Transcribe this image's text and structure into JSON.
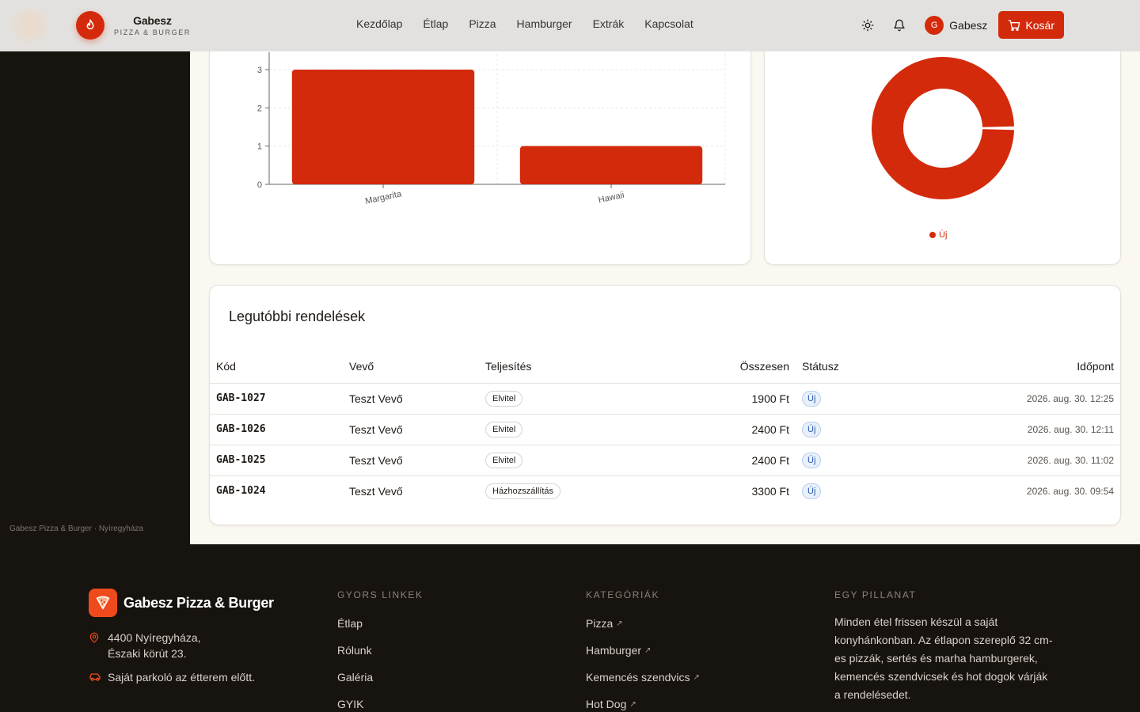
{
  "header": {
    "brand_name": "Gabesz",
    "brand_sub": "PIZZA & BURGER",
    "nav": [
      "Kezdőlap",
      "Étlap",
      "Pizza",
      "Hamburger",
      "Extrák",
      "Kapcsolat"
    ],
    "user_initial": "G",
    "user_name": "Gabesz",
    "cart_label": "Kosár"
  },
  "sidebar": {
    "footer_text": "Gabesz Pizza & Burger · Nyíregyháza"
  },
  "chart_data": [
    {
      "type": "bar",
      "categories": [
        "Margarita",
        "Hawaii"
      ],
      "values": [
        3,
        1
      ],
      "yticks": [
        "0",
        "1",
        "2",
        "3"
      ],
      "ylim": [
        0,
        3
      ],
      "color": "#d42a0c"
    },
    {
      "type": "pie",
      "variant": "donut",
      "labels": [
        "Új"
      ],
      "values": [
        100
      ],
      "legend": [
        "Új"
      ],
      "legend_position": "bottom",
      "color": "#d42a0c"
    }
  ],
  "orders": {
    "title": "Legutóbbi rendelések",
    "columns": [
      "Kód",
      "Vevő",
      "Teljesítés",
      "Összesen",
      "Státusz",
      "Időpont"
    ],
    "rows": [
      {
        "code": "GAB-1027",
        "buyer": "Teszt Vevő",
        "fulfil": "Elvitel",
        "total": "1900 Ft",
        "status": "Új",
        "time": "2026. aug. 30. 12:25"
      },
      {
        "code": "GAB-1026",
        "buyer": "Teszt Vevő",
        "fulfil": "Elvitel",
        "total": "2400 Ft",
        "status": "Új",
        "time": "2026. aug. 30. 12:11"
      },
      {
        "code": "GAB-1025",
        "buyer": "Teszt Vevő",
        "fulfil": "Elvitel",
        "total": "2400 Ft",
        "status": "Új",
        "time": "2026. aug. 30. 11:02"
      },
      {
        "code": "GAB-1024",
        "buyer": "Teszt Vevő",
        "fulfil": "Házhozszállítás",
        "total": "3300 Ft",
        "status": "Új",
        "time": "2026. aug. 30. 09:54"
      }
    ]
  },
  "footer": {
    "brand_name": "Gabesz Pizza & Burger",
    "address_line1": "4400 Nyíregyháza,",
    "address_line2": "Északi körút 23.",
    "parking": "Saját parkoló az étterem előtt.",
    "quick_links_title": "GYORS LINKEK",
    "quick_links": [
      "Étlap",
      "Rólunk",
      "Galéria",
      "GYIK"
    ],
    "categories_title": "KATEGÓRIÁK",
    "categories": [
      "Pizza",
      "Hamburger",
      "Kemencés szendvics",
      "Hot Dog"
    ],
    "about_title": "EGY PILLANAT",
    "about_text": "Minden étel frissen készül a saját konyhánkonban. Az étlapon szereplő 32 cm-es pizzák, sertés és marha hamburgerek, kemencés szendvicsek és hot dogok várják a rendelésedet."
  },
  "colors": {
    "accent": "#d42a0c",
    "footer_bg": "#17130f",
    "page_bg": "#fbf7f1"
  }
}
